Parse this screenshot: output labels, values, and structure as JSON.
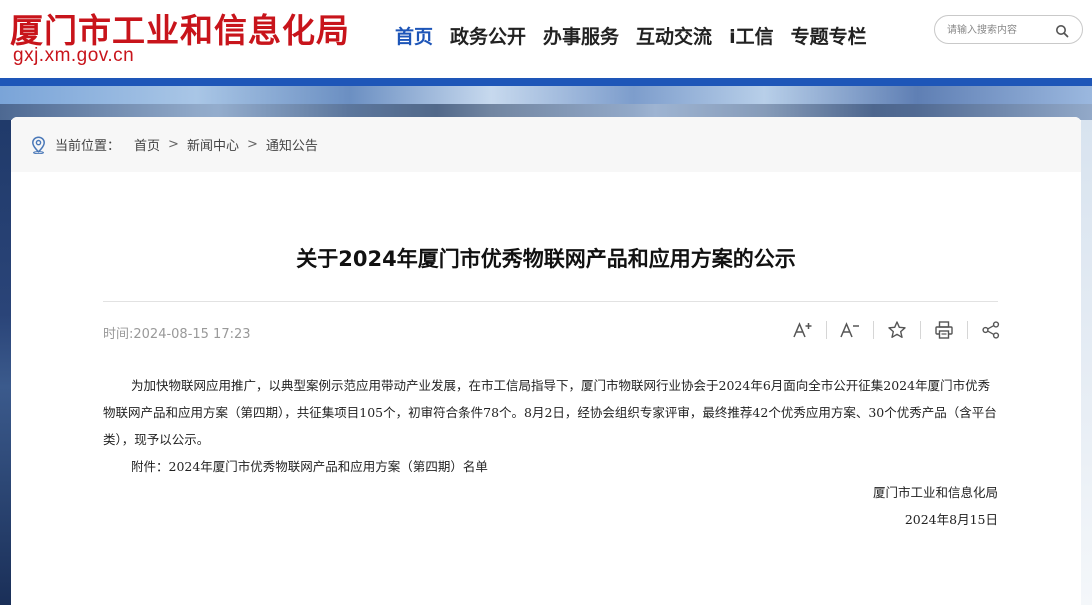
{
  "header": {
    "site_title": "厦门市工业和信息化局",
    "site_domain": "gxj.xm.gov.cn",
    "nav": [
      "首页",
      "政务公开",
      "办事服务",
      "互动交流",
      "i工信",
      "专题专栏"
    ],
    "active_nav_index": 0,
    "search": {
      "placeholder": "请输入搜索内容",
      "icon": "search-icon"
    }
  },
  "breadcrumb": {
    "label": "当前位置：",
    "items": [
      "首页",
      "新闻中心",
      "通知公告"
    ],
    "separator": ">",
    "icon": "location-pin-icon"
  },
  "article": {
    "title": "关于2024年厦门市优秀物联网产品和应用方案的公示",
    "time": "时间:2024-08-15 17:23",
    "tools": [
      "font-increase-icon",
      "font-decrease-icon",
      "star-icon",
      "print-icon",
      "share-icon"
    ],
    "paragraphs": [
      "为加快物联网应用推广，以典型案例示范应用带动产业发展，在市工信局指导下，厦门市物联网行业协会于2024年6月面向全市公开征集2024年厦门市优秀物联网产品和应用方案（第四期），共征集项目105个，初审符合条件78个。8月2日，经协会组织专家评审，最终推荐42个优秀应用方案、30个优秀产品（含平台类），现予以公示。",
      "附件：2024年厦门市优秀物联网产品和应用方案（第四期）名单"
    ],
    "signature_org": "厦门市工业和信息化局",
    "signature_date": "2024年8月15日"
  },
  "colors": {
    "brand_red": "#c8141b",
    "nav_active": "#1d55b8",
    "band_blue": "#1e56b8"
  }
}
